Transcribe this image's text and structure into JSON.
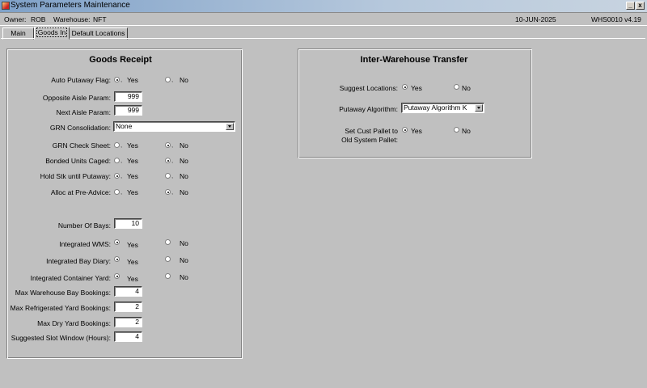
{
  "window": {
    "title": "System Parameters Maintenance",
    "minimize": "_",
    "close": "x"
  },
  "info": {
    "owner_label": "Owner:",
    "owner": "ROB",
    "warehouse_label": "Warehouse:",
    "warehouse": "NFT",
    "date": "10-JUN-2025",
    "version": "WHS0010  v4.19"
  },
  "tabs": [
    "Main",
    "Goods In",
    "Default Locations"
  ],
  "active_tab": "Goods In",
  "goods_receipt": {
    "heading": "Goods Receipt",
    "auto_putaway": {
      "label": "Auto Putaway Flag:",
      "yes": "Yes",
      "no": "No",
      "selected": "Yes"
    },
    "opposite_aisle": {
      "label": "Opposite Aisle Param:",
      "value": "999"
    },
    "next_aisle": {
      "label": "Next Aisle Param:",
      "value": "999"
    },
    "grn_consolidation": {
      "label": "GRN Consolidation:",
      "value": "None"
    },
    "grn_check_sheet": {
      "label": "GRN Check Sheet:",
      "yes": "Yes",
      "no": "No",
      "selected": "No"
    },
    "bonded_units": {
      "label": "Bonded Units Caged:",
      "yes": "Yes",
      "no": "No",
      "selected": "No"
    },
    "hold_stk": {
      "label": "Hold Stk until Putaway:",
      "yes": "Yes",
      "no": "No",
      "selected": "Yes"
    },
    "alloc_pre_advice": {
      "label": "Alloc at Pre-Advice:",
      "yes": "Yes",
      "no": "No",
      "selected": "No"
    },
    "number_of_bays": {
      "label": "Number Of Bays:",
      "value": "10"
    },
    "integrated_wms": {
      "label": "Integrated WMS:",
      "yes": "Yes",
      "no": "No",
      "selected": "Yes"
    },
    "integrated_bay_diary": {
      "label": "Integrated Bay Diary:",
      "yes": "Yes",
      "no": "No",
      "selected": "Yes"
    },
    "integrated_container_yard": {
      "label": "Integrated Container Yard:",
      "yes": "Yes",
      "no": "No",
      "selected": "Yes"
    },
    "max_warehouse_bay": {
      "label": "Max Warehouse Bay Bookings:",
      "value": "4"
    },
    "max_refrigerated_yard": {
      "label": "Max Refrigerated Yard Bookings:",
      "value": "2"
    },
    "max_dry_yard": {
      "label": "Max Dry Yard Bookings:",
      "value": "2"
    },
    "suggested_slot_window": {
      "label": "Suggested Slot Window (Hours):",
      "value": "4"
    }
  },
  "inter_warehouse": {
    "heading": "Inter-Warehouse Transfer",
    "suggest_locations": {
      "label": "Suggest Locations:",
      "yes": "Yes",
      "no": "No",
      "selected": "Yes"
    },
    "putaway_algorithm": {
      "label": "Putaway Algorithm:",
      "value": "Putaway Algorithm K"
    },
    "set_cust_pallet": {
      "label_line1": "Set Cust Pallet to",
      "label_line2": "Old System Pallet:",
      "yes": "Yes",
      "no": "No",
      "selected": "Yes"
    }
  },
  "icons": [
    "app-icon",
    "minimize-icon",
    "close-icon",
    "dropdown-arrow-icon"
  ]
}
